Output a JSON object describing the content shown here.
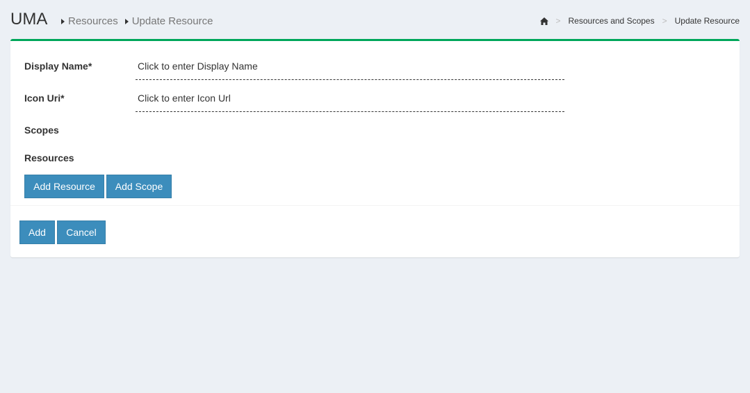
{
  "header": {
    "title": "UMA",
    "crumbs": [
      "Resources",
      "Update Resource"
    ]
  },
  "breadcrumb": {
    "home_icon": "home-icon",
    "items": [
      "Resources and Scopes",
      "Update Resource"
    ],
    "separator": ">"
  },
  "form": {
    "display_name": {
      "label": "Display Name*",
      "value": "Click to enter Display Name"
    },
    "icon_uri": {
      "label": "Icon Uri*",
      "value": "Click to enter Icon Url"
    },
    "scopes_label": "Scopes",
    "resources_label": "Resources",
    "add_resource_label": "Add Resource",
    "add_scope_label": "Add Scope"
  },
  "footer": {
    "add_label": "Add",
    "cancel_label": "Cancel"
  },
  "colors": {
    "accent": "#00a65a",
    "primary": "#3c8dbc",
    "background": "#ecf0f5"
  }
}
